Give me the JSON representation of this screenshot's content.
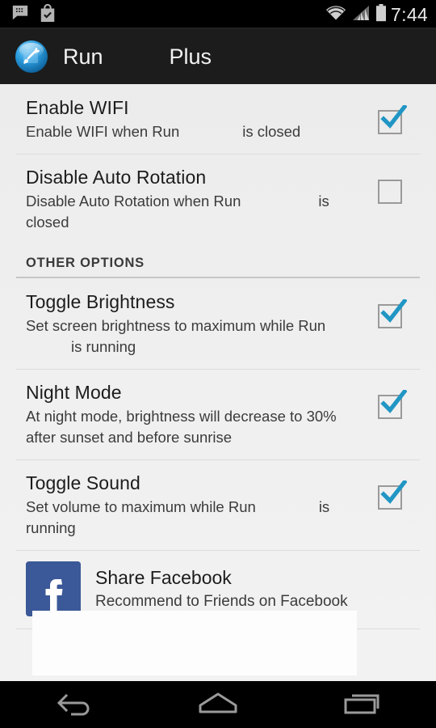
{
  "status_bar": {
    "time": "7:44",
    "left_icons": [
      "bbm-chat-icon",
      "play-store-bag-icon"
    ],
    "right_icons": [
      "wifi-icon",
      "cellular-signal-icon",
      "battery-icon"
    ]
  },
  "action_bar": {
    "icon": "app-tools-icon",
    "title": "Run",
    "title_secondary": "Plus"
  },
  "preferences": [
    {
      "title": "Enable WIFI",
      "summary_a": "Enable WIFI when Run",
      "summary_b": "is closed",
      "checked": true
    },
    {
      "title": "Disable Auto Rotation",
      "summary_a": "Disable Auto Rotation when Run",
      "summary_b": "is closed",
      "checked": false
    }
  ],
  "section": {
    "header": "OTHER OPTIONS",
    "items": [
      {
        "title": "Toggle Brightness",
        "summary_a": "Set screen brightness to maximum while Run",
        "summary_b": "is running",
        "checked": true
      },
      {
        "title": "Night Mode",
        "summary_a": "At night mode, brightness will decrease to 30% after sunset and before sunrise",
        "summary_b": "",
        "checked": true
      },
      {
        "title": "Toggle Sound",
        "summary_a": "Set volume to maximum while Run",
        "summary_b": "is running",
        "checked": true
      }
    ]
  },
  "facebook": {
    "icon": "facebook-icon",
    "title": "Share Facebook",
    "subtitle": "Recommend to Friends on Facebook"
  },
  "nav_bar": {
    "back": "back-icon",
    "home": "home-icon",
    "recents": "recents-icon"
  },
  "colors": {
    "accent_blue": "#2196c4",
    "facebook_blue": "#3b5998",
    "action_bar": "#1c1c1c",
    "list_bg": "#efefef"
  }
}
